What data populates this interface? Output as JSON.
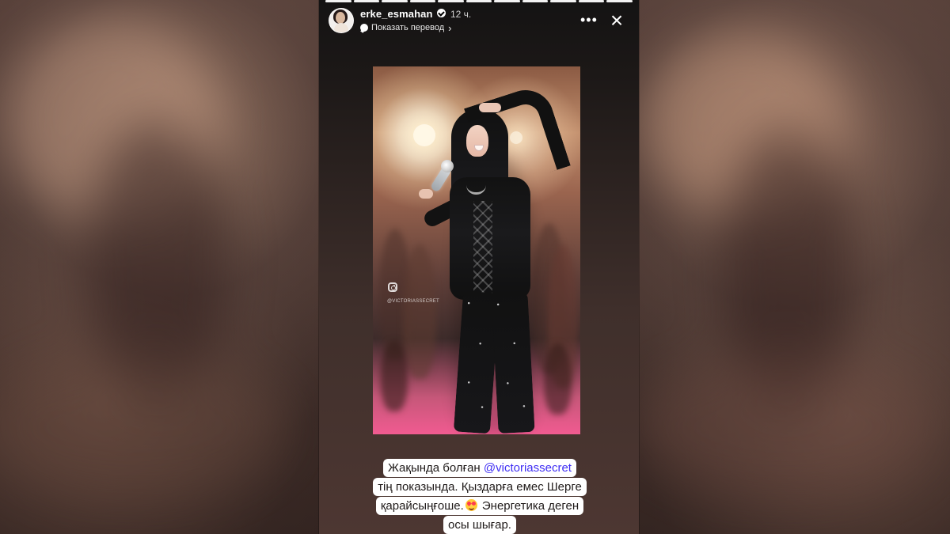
{
  "header": {
    "username": "erke_esmahan",
    "time_ago": "12 ч.",
    "translate_label": "Показать перевод",
    "more_label": "•••",
    "close_label": "×"
  },
  "progress": {
    "segments_total": 11,
    "segments_filled": 11
  },
  "media": {
    "watermark_text": "@VICTORIASSECRET",
    "instagram_icon": "instagram-icon"
  },
  "caption": {
    "line1_prefix": "Жақында болған ",
    "line1_mention": "@victoriassecret",
    "line2": "тің показында. Қыздарға емес Шерге",
    "line3_prefix": "қарайсыңғоше.",
    "line3_suffix": " Энергетика деген",
    "line4": "осы шығар."
  },
  "icons": {
    "verified": "verified-icon",
    "translate": "translate-icon",
    "more": "more-icon",
    "close": "close-icon",
    "emoji": "heart-eyes-emoji-icon"
  },
  "colors": {
    "accent": "#3f2ef4",
    "caption_bg": "#ffffff"
  }
}
